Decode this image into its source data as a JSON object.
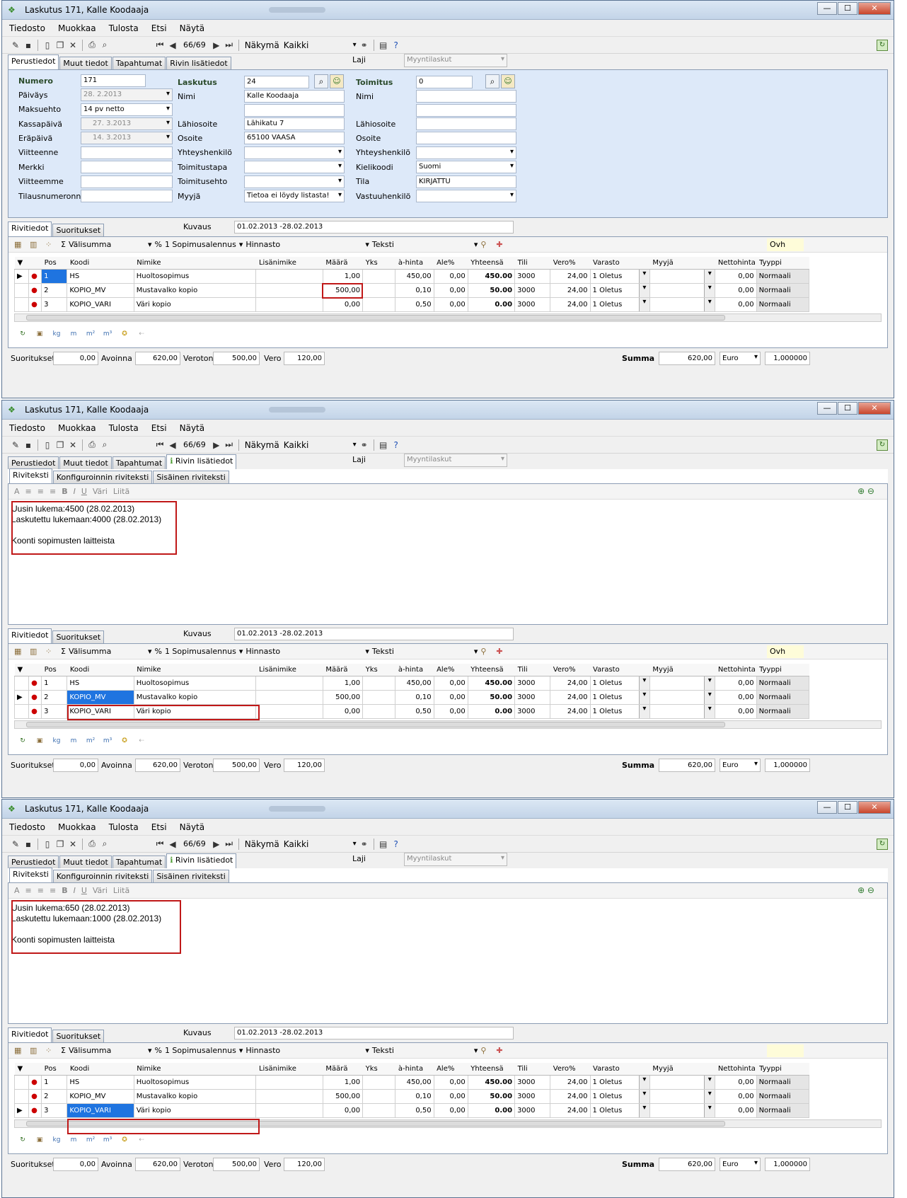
{
  "window_title": "Laskutus 171, Kalle Koodaaja",
  "window_controls": [
    "—",
    "☐",
    "✕"
  ],
  "menu": [
    "Tiedosto",
    "Muokkaa",
    "Tulosta",
    "Etsi",
    "Näytä"
  ],
  "toolbar": {
    "record": "66/69",
    "view_label": "Näkymä",
    "view_value": "Kaikki"
  },
  "tabs": [
    "Perustiedot",
    "Muut tiedot",
    "Tapahtumat",
    "Rivin lisätiedot"
  ],
  "laji_label": "Laji",
  "laji_value": "Myyntilaskut",
  "form": {
    "numero_label": "Numero",
    "numero": "171",
    "paivays_label": "Päiväys",
    "paivays": "28. 2.2013",
    "maksuehto_label": "Maksuehto",
    "maksuehto": "14 pv netto",
    "kassapaiva_label": "Kassapäivä",
    "kassapaiva": "27. 3.2013",
    "erapaiva_label": "Eräpäivä",
    "erapaiva": "14. 3.2013",
    "viitteenne_label": "Viitteenne",
    "merkki_label": "Merkki",
    "viitteemme_label": "Viitteemme",
    "tilausnumeronne_label": "Tilausnumeronne",
    "laskutus_label": "Laskutus",
    "laskutus": "24",
    "nimi_label": "Nimi",
    "nimi": "Kalle Koodaaja",
    "lahiosoite_label": "Lähiosoite",
    "lahiosoite": "Lähikatu 7",
    "osoite_label": "Osoite",
    "osoite": "65100  VAASA",
    "yhteyshenkilo_label": "Yhteyshenkilö",
    "toimitustapa_label": "Toimitustapa",
    "toimitusehto_label": "Toimitusehto",
    "myyja_label": "Myyjä",
    "myyja": "Tietoa ei löydy listasta!",
    "toimitus_label": "Toimitus",
    "toimitus": "0",
    "kielikoodi_label": "Kielikoodi",
    "kielikoodi": "Suomi",
    "tila_label": "Tila",
    "tila": "KIRJATTU",
    "vastuuhenkilo_label": "Vastuuhenkilö"
  },
  "detail_tabs": [
    "Riviteksti",
    "Konfiguroinnin riviteksti",
    "Sisäinen riviteksti"
  ],
  "rte_toolbar": {
    "vari": "Väri",
    "liita": "Liitä"
  },
  "rte_text_2": [
    "Uusin lukema:4500  (28.02.2013)",
    "Laskutettu lukemaan:4000 (28.02.2013)",
    "",
    "Koonti sopimusten laitteista"
  ],
  "rte_text_3": [
    "Uusin lukema:650  (28.02.2013)",
    "Laskutettu lukemaan:1000 (28.02.2013)",
    "",
    "Koonti sopimusten laitteista"
  ],
  "row_tabs": [
    "Rivitiedot",
    "Suoritukset"
  ],
  "kuvaus_label": "Kuvaus",
  "kuvaus": "01.02.2013 -28.02.2013",
  "grid_toolbar": {
    "valisumma": "Välisumma",
    "sopimus": "1 Sopimusalennus",
    "hinnasto": "Hinnasto",
    "teksti": "Teksti",
    "ovh": "Ovh"
  },
  "columns": [
    "Pos",
    "Koodi",
    "Nimike",
    "Lisänimike",
    "Määrä",
    "Yks",
    "à-hinta",
    "Ale%",
    "Yhteensä",
    "Tili",
    "Vero%",
    "Varasto",
    "Myyjä",
    "Nettohinta",
    "Tyyppi"
  ],
  "rows": [
    {
      "pos": "1",
      "koodi": "HS",
      "nimike": "Huoltosopimus",
      "maara": "1,00",
      "hinta": "450,00",
      "ale": "0,00",
      "yht": "450.00",
      "tili": "3000",
      "vero": "24,00",
      "varasto": "1 Oletus",
      "netto": "0,00",
      "tyyppi": "Normaali"
    },
    {
      "pos": "2",
      "koodi": "KOPIO_MV",
      "nimike": "Mustavalko kopio",
      "maara": "500,00",
      "hinta": "0,10",
      "ale": "0,00",
      "yht": "50.00",
      "tili": "3000",
      "vero": "24,00",
      "varasto": "1 Oletus",
      "netto": "0,00",
      "tyyppi": "Normaali"
    },
    {
      "pos": "3",
      "koodi": "KOPIO_VARI",
      "nimike": "Väri kopio",
      "maara": "0,00",
      "hinta": "0,50",
      "ale": "0,00",
      "yht": "0.00",
      "tili": "3000",
      "vero": "24,00",
      "varasto": "1 Oletus",
      "netto": "0,00",
      "tyyppi": "Normaali"
    }
  ],
  "units_toolbar": [
    "kg",
    "m",
    "m²",
    "m³"
  ],
  "summary": {
    "suoritukset_label": "Suoritukset",
    "suoritukset": "0,00",
    "avoinna_label": "Avoinna",
    "avoinna": "620,00",
    "veroton_label": "Veroton",
    "veroton": "500,00",
    "vero_label": "Vero",
    "vero": "120,00",
    "summa_label": "Summa",
    "summa": "620,00",
    "currency": "Euro",
    "rate": "1,000000"
  }
}
